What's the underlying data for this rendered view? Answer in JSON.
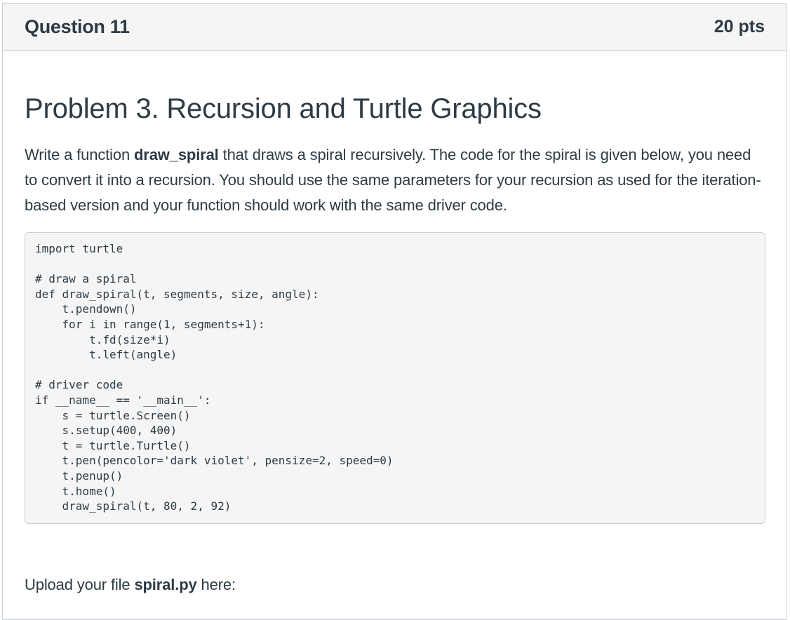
{
  "question": {
    "title": "Question 11",
    "points": "20 pts"
  },
  "problem": {
    "heading": "Problem 3. Recursion and Turtle Graphics",
    "desc_part1": "Write a function ",
    "desc_function": "draw_spiral",
    "desc_part2": " that draws a spiral recursively. The code for the spiral is given below, you need to convert it into a recursion. You should use the same parameters for your recursion as used for the iteration-based version and your function should work with the same driver code."
  },
  "code": "import turtle\n\n# draw a spiral\ndef draw_spiral(t, segments, size, angle):\n    t.pendown()\n    for i in range(1, segments+1):\n        t.fd(size*i)\n        t.left(angle)\n\n# driver code\nif __name__ == '__main__':\n    s = turtle.Screen()\n    s.setup(400, 400)\n    t = turtle.Turtle()\n    t.pen(pencolor='dark violet', pensize=2, speed=0)\n    t.penup()\n    t.home()\n    draw_spiral(t, 80, 2, 92)",
  "upload": {
    "prefix": "Upload your file ",
    "filename": "spiral.py",
    "suffix": " here:"
  }
}
